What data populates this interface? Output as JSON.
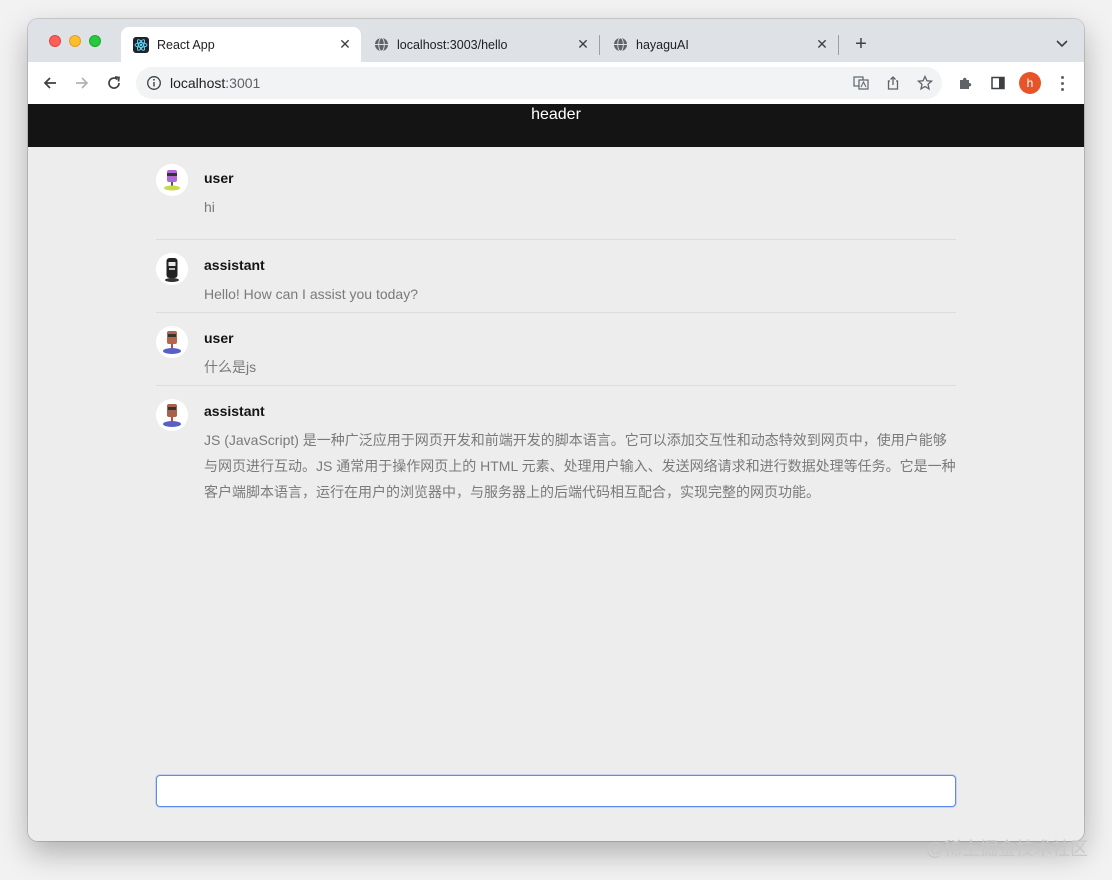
{
  "browser": {
    "tabs": [
      {
        "title": "React App",
        "icon": "react-icon",
        "active": true
      },
      {
        "title": "localhost:3003/hello",
        "icon": "globe-icon",
        "active": false
      },
      {
        "title": "hayaguAI",
        "icon": "globe-icon",
        "active": false
      }
    ],
    "url_host": "localhost",
    "url_port": ":3001",
    "profile_initial": "h",
    "profile_color": "#e8542a"
  },
  "app": {
    "header": "header",
    "messages": [
      {
        "role": "user",
        "content": "hi"
      },
      {
        "role": "assistant",
        "content": "Hello! How can I assist you today?"
      },
      {
        "role": "user",
        "content": "什么是js"
      },
      {
        "role": "assistant",
        "content": "JS (JavaScript) 是一种广泛应用于网页开发和前端开发的脚本语言。它可以添加交互性和动态特效到网页中，使用户能够与网页进行互动。JS 通常用于操作网页上的 HTML 元素、处理用户输入、发送网络请求和进行数据处理等任务。它是一种客户端脚本语言，运行在用户的浏览器中，与服务器上的后端代码相互配合，实现完整的网页功能。"
      }
    ],
    "input_value": ""
  },
  "watermark": "@稀土掘金技术社区"
}
